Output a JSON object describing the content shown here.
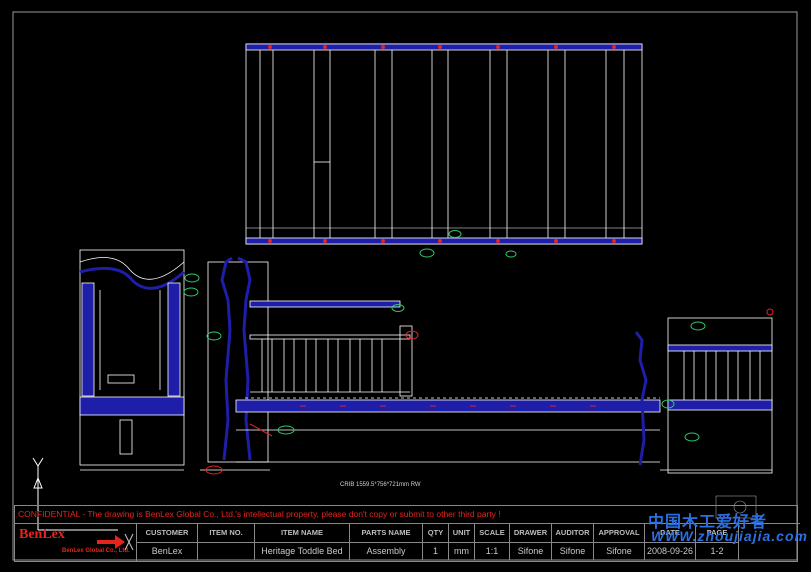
{
  "confidential_notice": "CONFIDENTIAL - The drawing is BenLex Global Co., Ltd.'s intellectual property, please don't copy or submit to other third party !",
  "logo": {
    "brand": "BenLex",
    "company": "BenLex Global Co., Ltd."
  },
  "dimension_note": "CRIB 1559.5*756*721mm RW",
  "watermark": {
    "line1": "中国木工爱好者",
    "line2": "WWW.zhoujiajia.com"
  },
  "title_block": {
    "headers": [
      "CUSTOMER",
      "ITEM NO.",
      "ITEM NAME",
      "PARTS NAME",
      "QTY",
      "UNIT",
      "SCALE",
      "DRAWER",
      "AUDITOR",
      "APPROVAL",
      "DATE",
      "PAGE"
    ],
    "values": [
      "BenLex",
      "",
      "Heritage Toddle Bed",
      "Assembly",
      "1",
      "mm",
      "1:1",
      "Sifone",
      "Sifone",
      "Sifone",
      "2008-09-26",
      "1-2"
    ]
  },
  "colors": {
    "line": "#ffffff",
    "accent_blue": "#1e1ea8",
    "marker_red": "#e8231c",
    "marker_green": "#2ec86a",
    "frame": "#9a9a9a"
  },
  "icons": [
    "ucs-axis-icon",
    "logo-arrow-icon"
  ]
}
